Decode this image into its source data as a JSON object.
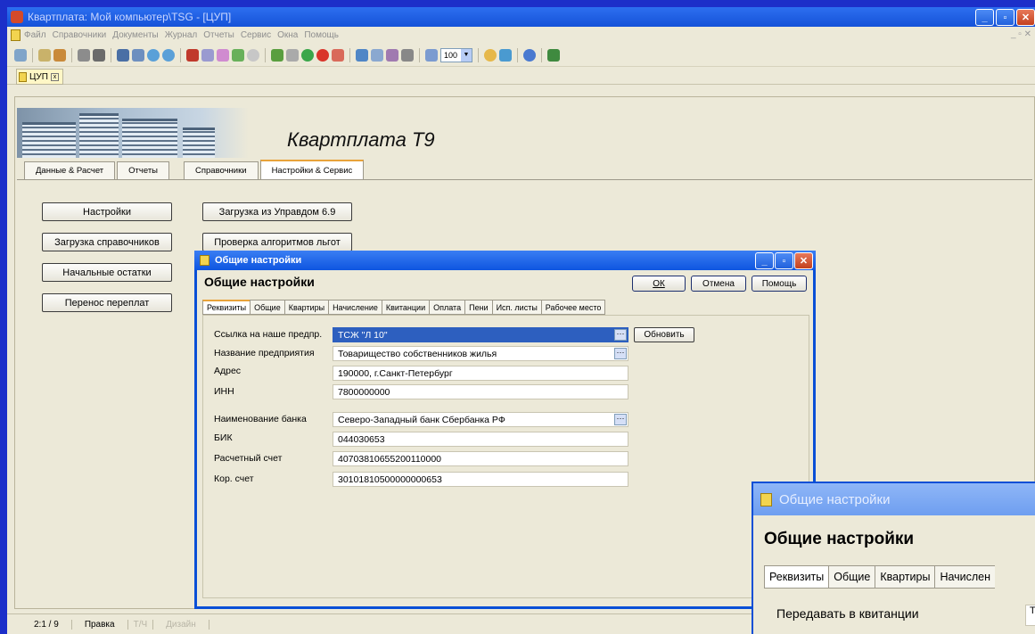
{
  "window": {
    "title": "Квартплата: Мой компьютер\\TSG - [ЦУП]",
    "btn_min": "_",
    "btn_max": "▫",
    "btn_close": "✕"
  },
  "menu": {
    "items": [
      "Файл",
      "Справочники",
      "Документы",
      "Журнал",
      "Отчеты",
      "Сервис",
      "Окна",
      "Помощь"
    ],
    "mdi_controls": "_ ▫ ✕"
  },
  "toolbar": {
    "zoom_value": "100"
  },
  "doc_tab": {
    "label": "ЦУП",
    "close": "x"
  },
  "app_title": "Квартплата Т9",
  "main_tabs": [
    "Данные & Расчет",
    "Отчеты",
    "Справочники",
    "Настройки & Сервис"
  ],
  "buttons": {
    "settings": "Настройки",
    "load_refs": "Загрузка справочников",
    "initial_balances": "Начальные остатки",
    "transfer_overpay": "Перенос переплат",
    "load_upravdom": "Загрузка из Управдом 6.9",
    "check_algorithms": "Проверка алгоритмов льгот"
  },
  "status": {
    "position": "2:1 / 9",
    "mode": "Правка",
    "t": "Т/Ч",
    "design": "Дизайн"
  },
  "dialog": {
    "title": "Общие настройки",
    "heading": "Общие настройки",
    "ok": "ОК",
    "cancel": "Отмена",
    "help": "Помощь",
    "tabs": [
      "Реквизиты",
      "Общие",
      "Квартиры",
      "Начисление",
      "Квитанции",
      "Оплата",
      "Пени",
      "Исп. листы",
      "Рабочее место"
    ],
    "refresh": "Обновить",
    "ellipsis": "···",
    "fields": [
      {
        "label": "Ссылка на наше предпр.",
        "value": "ТСЖ \"Л 10\""
      },
      {
        "label": "Название предприятия",
        "value": "Товарищество собственников жилья"
      },
      {
        "label": "Адрес",
        "value": "190000, г.Санкт-Петербург"
      },
      {
        "label": "ИНН",
        "value": "7800000000"
      },
      {
        "label": "Наименование банка",
        "value": "Северо-Западный банк Сбербанка РФ"
      },
      {
        "label": "БИК",
        "value": "044030653"
      },
      {
        "label": "Расчетный счет",
        "value": "40703810655200110000"
      },
      {
        "label": "Кор. счет",
        "value": "30101810500000000653"
      }
    ]
  },
  "zoom_inset": {
    "title": "Общие настройки",
    "heading": "Общие настройки",
    "tabs": [
      "Реквизиты",
      "Общие",
      "Квартиры",
      "Начислен"
    ],
    "label": "Передавать в квитанции",
    "field_value": "Т"
  }
}
